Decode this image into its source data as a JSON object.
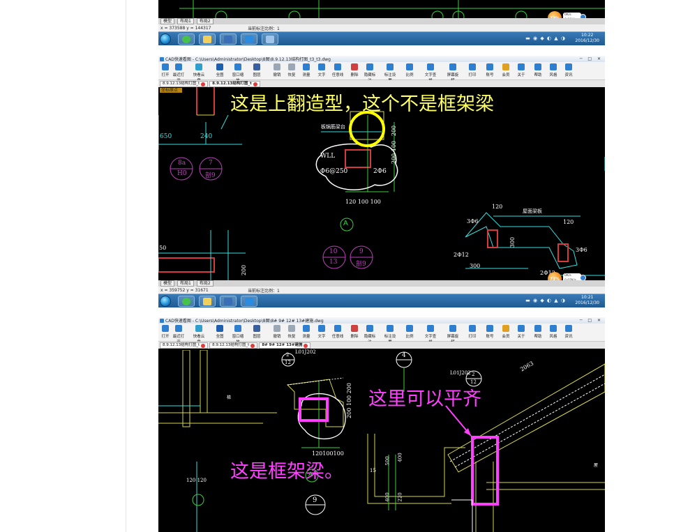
{
  "shot1": {
    "layout_tabs": [
      "模型",
      "布局1",
      "布局2"
    ],
    "coords": "x = 373588  y = 144317",
    "scale_label": "当前标注比例：1",
    "tray_time": "10:22",
    "tray_date": "2016/12/30",
    "net_percent": "73%",
    "net_up": "0K/s",
    "net_down": "0.09K/s"
  },
  "shot2": {
    "window_title": "CAD快速看图 - C:\\Users\\Administrator\\Desktop\\8图\\8.9.12.13结构打图_t3_t3.dwg",
    "ribbon": [
      "打开",
      "最近打开",
      "快看云盘",
      "全图",
      "窗口缩放",
      "图层",
      "撤销",
      "恢复",
      "测量",
      "文字",
      "任意线",
      "删除",
      "隐藏标注",
      "标注设置",
      "比例",
      "文字查找",
      "屏幕旋转",
      "打印",
      "账号",
      "会员",
      "关于",
      "帮助",
      "风格",
      "资讯"
    ],
    "doc_tabs": [
      "8.9.12.13结构打图_t",
      "8.9.12.13结构打图_t"
    ],
    "annotation": "这是上翻造型，这个不是框架梁",
    "cad_labels": {
      "member": "板锅筋梁台",
      "beam": "WLL",
      "rebar": "Φ6@250",
      "bar2": "2Φ6",
      "dims_v": [
        "200",
        "100",
        "200"
      ],
      "dims_h": "120 100 100",
      "axis_a": "A",
      "d650": "650",
      "d240": "240",
      "circle1_top": "8a",
      "circle1_bot": "H0",
      "circle2_top": "7",
      "circle2_bot": "剖9",
      "circle3_top": "10",
      "circle3_bot": "13",
      "circle4_top": "9",
      "circle4_bot": "剖9",
      "left_label": "坐标原点",
      "r120a": "120",
      "r120b": "120",
      "r_title": "屋面梁板",
      "r3o6": "3Φ6",
      "r2o12a": "2Φ12",
      "r2o12b": "2Φ12",
      "r300a": "300",
      "r300b": "300",
      "r3o6b": "3Φ6",
      "d50": "50",
      "d200b": "200"
    },
    "layout_tabs": [
      "模型",
      "布局1",
      "布局2"
    ],
    "coords": "x = 359752  y = 31671",
    "scale_label": "当前标注比例：1",
    "tray_time": "10:21",
    "tray_date": "2016/12/30",
    "net_percent": "73%",
    "net_up": "0K/s",
    "net_down": "0.07K/s"
  },
  "shot3": {
    "window_title": "CAD快速看图 - C:\\Users\\Administrator\\Desktop\\8图\\8# 9# 12# 13#建施.dwg",
    "ribbon": [
      "打开",
      "最近打开",
      "快看云盘",
      "全图",
      "窗口缩放",
      "图层",
      "撤销",
      "恢复",
      "测量",
      "文字",
      "任意线",
      "删除",
      "隐藏标注",
      "标注设置",
      "比例",
      "文字查找",
      "屏幕旋转",
      "打印",
      "账号",
      "会员",
      "关于",
      "帮助",
      "风格",
      "资讯"
    ],
    "doc_tabs": [
      "8.9.12.13结构打图_t",
      "8.9.12.13结构打图_t",
      "8# 9# 12# 13#建施"
    ],
    "annotation_right": "这里可以平齐",
    "annotation_left": "这是框架梁。",
    "cad_labels": {
      "ref_a": "L01J202",
      "ref_a_num_top": "2",
      "ref_a_num_bot": "12",
      "ref_b": "L01J202",
      "ref_b_num_top": "2",
      "ref_b_num_bot": "12",
      "axis4": "4",
      "dim_2063": "2063",
      "dims_v": "200 100 200",
      "dims_h": "120100100",
      "d120": "120",
      "d15": "15",
      "d500": "500",
      "d400": "400",
      "d220": "220",
      "bubble9": "9",
      "axis_a": "A",
      "stair": "梯",
      "wall_tag": "屋",
      "left_dims": "120 120"
    }
  },
  "colors": {
    "annot_yellow": "#ffff66",
    "annot_magenta": "#ff40ff",
    "cad_cyan": "#35e0e0",
    "cad_green": "#3bd13b",
    "cad_red": "#d63a3a",
    "cad_magenta": "#c040c0",
    "cad_yellow": "#d6d64a"
  }
}
